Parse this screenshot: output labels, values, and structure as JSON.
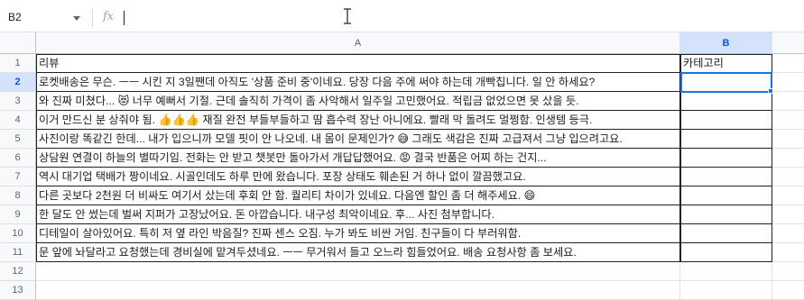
{
  "formula_bar": {
    "cell_reference": "B2",
    "function_icon": "fx",
    "content": ""
  },
  "columns": [
    {
      "label": "A",
      "selected": false
    },
    {
      "label": "B",
      "selected": true
    }
  ],
  "rows": [
    {
      "number": "1",
      "a": "리뷰",
      "b": "카테고리"
    },
    {
      "number": "2",
      "a": "로켓배송은 무슨. ㅡㅡ 시킨 지 3일짼데 아직도 '상품 준비 중'이네요. 당장 다음 주에 써야 하는데 개빡칩니다. 일 안 하세요?",
      "b": ""
    },
    {
      "number": "3",
      "a": "와 진짜 미쳤다... 😻 너무 예뻐서 기절. 근데 솔직히 가격이 좀 사악해서 일주일 고민했어요. 적립금 없었으면 못 샀을 듯.",
      "b": ""
    },
    {
      "number": "4",
      "a": "이거 만드신 분 상줘야 됨. 👍👍👍 재질 완전 부들부들하고 땀 흡수력 장난 아니에요. 빨래 막 돌려도 멀쩡함. 인생템 등극.",
      "b": ""
    },
    {
      "number": "5",
      "a": "사진이랑 똑같긴 한데... 내가 입으니까 모델 핏이 안 나오네. 내 몸이 문제인가? 😅 그래도 색감은 진짜 고급져서 그냥 입으려고요.",
      "b": ""
    },
    {
      "number": "6",
      "a": "상담원 연결이 하늘의 별따기임. 전화는 안 받고 챗봇만 돌아가서 개답답했어요. 😡 결국 반품은 어찌 하는 건지...",
      "b": ""
    },
    {
      "number": "7",
      "a": "역시 대기업 택배가 짱이네요. 시골인데도 하루 만에 왔습니다. 포장 상태도 훼손된 거 하나 없이 깔끔했고요.",
      "b": ""
    },
    {
      "number": "8",
      "a": "다른 곳보다 2천원 더 비싸도 여기서 샀는데 후회 안 함. 퀄리티 차이가 있네요. 다음엔 할인 좀 더 해주세요. 😄",
      "b": ""
    },
    {
      "number": "9",
      "a": "한 달도 안 썼는데 벌써 지퍼가 고장났어요. 돈 아깝습니다. 내구성 최악이네요. 후... 사진 첨부합니다.",
      "b": ""
    },
    {
      "number": "10",
      "a": "디테일이 살아있어요. 특히 저 옆 라인 박음질? 진짜 센스 오짐. 누가 봐도 비싼 거임. 친구들이 다 부러워함.",
      "b": ""
    },
    {
      "number": "11",
      "a": "문 앞에 놔달라고 요청했는데 경비실에 맡겨두셨네요. ㅡㅡ 무거워서 들고 오느라 힘들었어요. 배송 요청사항 좀 보세요.",
      "b": ""
    },
    {
      "number": "12",
      "a": "",
      "b": ""
    },
    {
      "number": "13",
      "a": "",
      "b": ""
    }
  ],
  "selected_cell": "B2",
  "colors": {
    "selection": "#1a73e8",
    "header_selected_bg": "#d3e3fd",
    "header_selected_text": "#0b57d0"
  }
}
